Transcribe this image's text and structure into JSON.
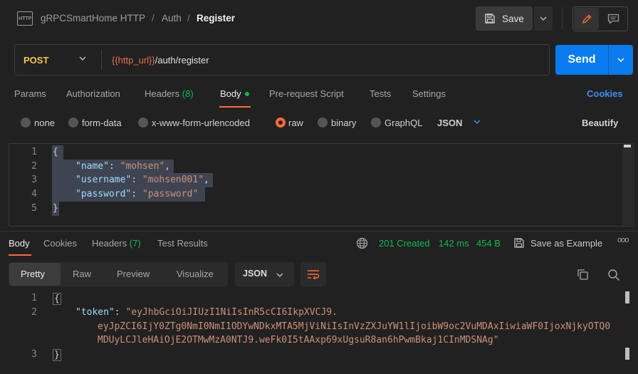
{
  "breadcrumb": {
    "icon_text": "HTTP",
    "collection": "gRPCSmartHome HTTP",
    "separator": "/",
    "folder": "Auth",
    "request": "Register"
  },
  "toolbar": {
    "save_label": "Save",
    "icons": [
      "floppy-icon",
      "chevron-down-icon",
      "pencil-icon",
      "comment-icon"
    ]
  },
  "request": {
    "method": "POST",
    "url_variable": "{{http_url}}",
    "url_path": "/auth/register",
    "send_label": "Send"
  },
  "request_tabs": [
    {
      "label": "Params"
    },
    {
      "label": "Authorization"
    },
    {
      "label": "Headers",
      "count": "(8)"
    },
    {
      "label": "Body",
      "active": true
    },
    {
      "label": "Pre-request Script"
    },
    {
      "label": "Tests"
    },
    {
      "label": "Settings"
    }
  ],
  "cookies_link": "Cookies",
  "body_types": {
    "options": [
      "none",
      "form-data",
      "x-www-form-urlencoded",
      "raw",
      "binary",
      "GraphQL"
    ],
    "selected": "raw",
    "format": "JSON",
    "beautify_label": "Beautify"
  },
  "request_body": {
    "line_numbers": [
      "1",
      "2",
      "3",
      "4",
      "5"
    ],
    "open_brace": "{",
    "close_brace": "}",
    "fields": [
      {
        "key": "\"name\"",
        "value": "\"mohsen\"",
        "trail": ","
      },
      {
        "key": "\"username\"",
        "value": "\"mohsen001\"",
        "trail": ","
      },
      {
        "key": "\"password\"",
        "value": "\"password\"",
        "trail": ""
      }
    ]
  },
  "response_tabs": [
    {
      "label": "Body",
      "active": true
    },
    {
      "label": "Cookies"
    },
    {
      "label": "Headers",
      "count": "(7)"
    },
    {
      "label": "Test Results"
    }
  ],
  "response_meta": {
    "status": "201 Created",
    "time": "142 ms",
    "size": "454 B",
    "save_example": "Save as Example",
    "more": "ooo"
  },
  "response_view": {
    "modes": [
      "Pretty",
      "Raw",
      "Preview",
      "Visualize"
    ],
    "active_mode": "Pretty",
    "format": "JSON"
  },
  "response_body": {
    "line_numbers": [
      "1",
      "2",
      "3"
    ],
    "open_brace": "{",
    "close_brace": "}",
    "key": "\"token\"",
    "token_lines": [
      "\"eyJhbGciOiJIUzI1NiIsInR5cCI6IkpXVCJ9.",
      "eyJpZCI6IjY0ZTg0NmI0NmI1ODYwNDkxMTA5MjViNiIsInVzZXJuYW1lIjoibW9oc2VuMDAxIiwiaWF0IjoxNjkyOTQ0",
      "MDUyLCJleHAiOjE2OTMwMzA0NTJ9.weFk0I5tAAxp69xUgsuR8an6hPwmBkaj1CInMDSNAg\""
    ]
  },
  "colors": {
    "accent": "#ff6c37",
    "primary": "#097bed",
    "method": "#f2c94c",
    "success": "#0cbb52"
  }
}
